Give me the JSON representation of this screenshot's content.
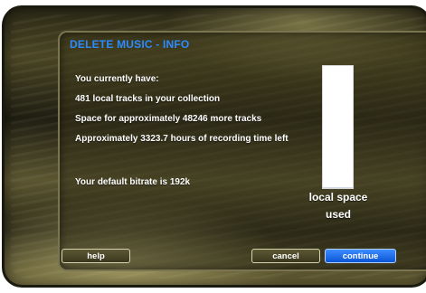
{
  "dialog": {
    "title": "DELETE MUSIC - INFO",
    "lines": [
      "You currently have:",
      "481 local tracks in your collection",
      "Space for approximately 48246 more tracks",
      "Approximately 3323.7 hours of recording time left",
      "Your default bitrate is 192k"
    ]
  },
  "storage_meter": {
    "caption_line1": "local space",
    "caption_line2": "used",
    "used_fraction": 0.01
  },
  "buttons": {
    "help": "help",
    "cancel": "cancel",
    "continue": "continue"
  },
  "colors": {
    "accent": "#2a8bff",
    "primary_button": "#1e6df0"
  }
}
